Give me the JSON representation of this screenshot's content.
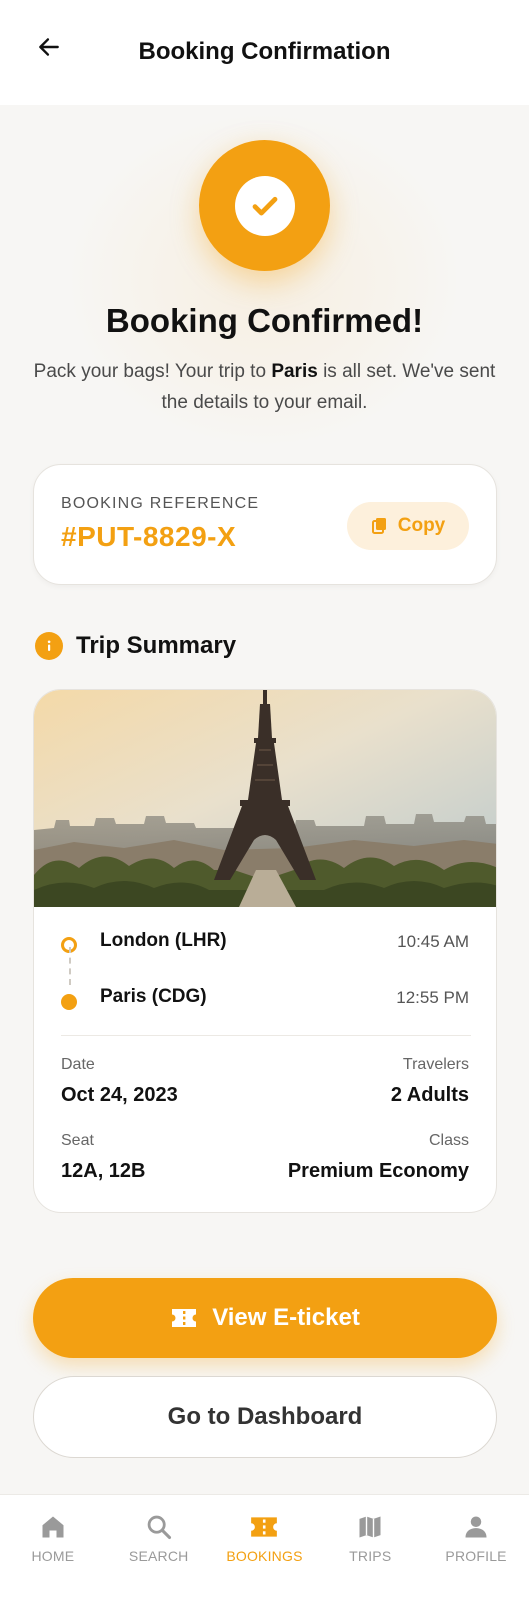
{
  "header": {
    "title": "Booking Confirmation",
    "back_icon": "arrow-left-icon"
  },
  "confirmation": {
    "title": "Booking Confirmed!",
    "subtitle_before": "Pack your bags! Your trip to ",
    "destination": "Paris",
    "subtitle_after": " is all set. We've sent the details to your email."
  },
  "reference": {
    "label": "BOOKING REFERENCE",
    "code": "#PUT-8829-X",
    "copy_label": "Copy"
  },
  "trip_summary": {
    "title": "Trip Summary",
    "origin": {
      "city": "London (LHR)",
      "time": "10:45 AM"
    },
    "destination": {
      "city": "Paris (CDG)",
      "time": "12:55 PM"
    },
    "details": {
      "date_label": "Date",
      "date_value": "Oct 24, 2023",
      "travelers_label": "Travelers",
      "travelers_value": "2 Adults",
      "seat_label": "Seat",
      "seat_value": "12A, 12B",
      "class_label": "Class",
      "class_value": "Premium Economy"
    }
  },
  "actions": {
    "primary_label": "View E-ticket",
    "secondary_label": "Go to Dashboard"
  },
  "nav": {
    "items": [
      {
        "label": "HOME",
        "icon": "home-icon"
      },
      {
        "label": "SEARCH",
        "icon": "search-icon"
      },
      {
        "label": "BOOKINGS",
        "icon": "ticket-icon",
        "active": true
      },
      {
        "label": "TRIPS",
        "icon": "map-icon"
      },
      {
        "label": "PROFILE",
        "icon": "person-icon"
      }
    ]
  },
  "colors": {
    "accent": "#f3a012",
    "accent_light": "#fdf0dc",
    "background": "#f7f6f4",
    "text": "#111111"
  }
}
